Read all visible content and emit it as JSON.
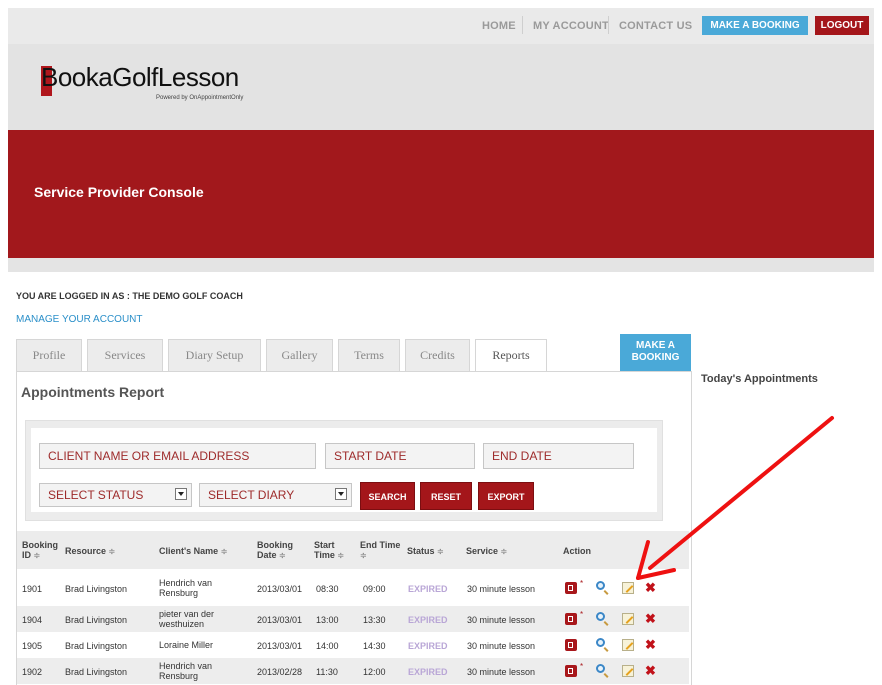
{
  "topnav": {
    "home": "HOME",
    "my_account": "MY ACCOUNT",
    "contact_us": "CONTACT US",
    "make_booking": "MAKE A BOOKING",
    "logout": "LOGOUT"
  },
  "logo": {
    "initial": "B",
    "text": "ookaGolfLesson",
    "powered_by": "Powered by OnAppointmentOnly"
  },
  "banner": {
    "title": "Service Provider Console"
  },
  "account": {
    "logged_in_as": "YOU ARE LOGGED IN AS : THE DEMO GOLF COACH",
    "manage_link": "MANAGE YOUR ACCOUNT"
  },
  "tabs": [
    {
      "label": "Profile"
    },
    {
      "label": "Services"
    },
    {
      "label": "Diary Setup"
    },
    {
      "label": "Gallery"
    },
    {
      "label": "Terms"
    },
    {
      "label": "Credits"
    },
    {
      "label": "Reports"
    }
  ],
  "tab_book": {
    "line1": "MAKE A",
    "line2": "BOOKING"
  },
  "report": {
    "title": "Appointments Report"
  },
  "sidebar": {
    "title": "Today's Appointments"
  },
  "filters": {
    "client_placeholder": "CLIENT NAME OR EMAIL ADDRESS",
    "start_date": "START DATE",
    "end_date": "END DATE",
    "status": "SELECT STATUS",
    "diary": "SELECT DIARY",
    "search": "SEARCH",
    "reset": "RESET",
    "export": "EXPORT"
  },
  "table": {
    "headers": {
      "booking_id_1": "Booking",
      "booking_id_2": "ID",
      "resource": "Resource",
      "client": "Client's Name",
      "booking_date_1": "Booking",
      "booking_date_2": "Date",
      "start_1": "Start",
      "start_2": "Time",
      "end": "End Time",
      "status": "Status",
      "service": "Service",
      "action": "Action"
    },
    "sort_glyph": "≑",
    "rows": [
      {
        "id": "1901",
        "resource": "Brad Livingston",
        "client1": "Hendrich van",
        "client2": "Rensburg",
        "date": "2013/03/01",
        "start": "08:30",
        "end": "09:00",
        "status": "EXPIRED",
        "service": "30 minute lesson"
      },
      {
        "id": "1904",
        "resource": "Brad Livingston",
        "client1": "pieter van der",
        "client2": "westhuizen",
        "date": "2013/03/01",
        "start": "13:00",
        "end": "13:30",
        "status": "EXPIRED",
        "service": "30 minute lesson"
      },
      {
        "id": "1905",
        "resource": "Brad Livingston",
        "client1": "Loraine Miller",
        "client2": "",
        "date": "2013/03/01",
        "start": "14:00",
        "end": "14:30",
        "status": "EXPIRED",
        "service": "30 minute lesson"
      },
      {
        "id": "1902",
        "resource": "Brad Livingston",
        "client1": "Hendrich van",
        "client2": "Rensburg",
        "date": "2013/02/28",
        "start": "11:30",
        "end": "12:00",
        "status": "EXPIRED",
        "service": "30 minute lesson"
      }
    ]
  },
  "icons": [
    "book-icon",
    "required-star-icon",
    "view-magnifier-icon",
    "edit-pencil-icon",
    "delete-x-icon",
    "arrow-annotation-icon"
  ],
  "colors": {
    "brand_red": "#a2181c",
    "accent_blue": "#4aa9d8",
    "annotation_red": "#ee1111"
  }
}
